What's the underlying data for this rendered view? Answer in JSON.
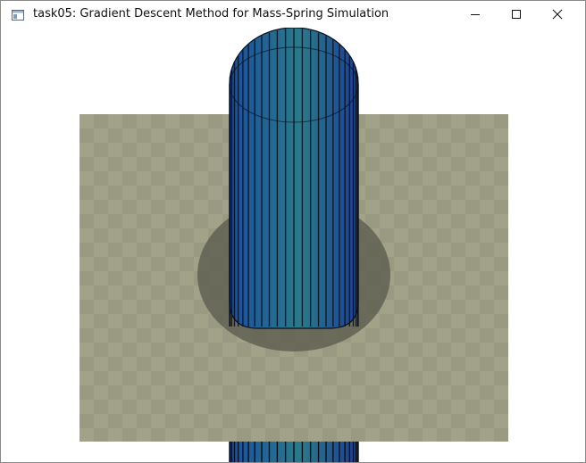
{
  "window": {
    "title": "task05: Gradient Descent Method for Mass-Spring Simulation",
    "icon": "app-window-icon",
    "controls": {
      "minimize_icon": "minimize-icon",
      "maximize_icon": "maximize-icon",
      "close_icon": "close-icon"
    }
  },
  "scene": {
    "floor_colors": {
      "light": "#a2a288",
      "dark": "#9a9a82"
    },
    "shadow_color": "#5b5b4f",
    "cylinder_colors": {
      "left": "#1a4f9e",
      "mid": "#2a7a8a",
      "right": "#1d3f93"
    },
    "stripe_color": "#0a0f1c"
  }
}
